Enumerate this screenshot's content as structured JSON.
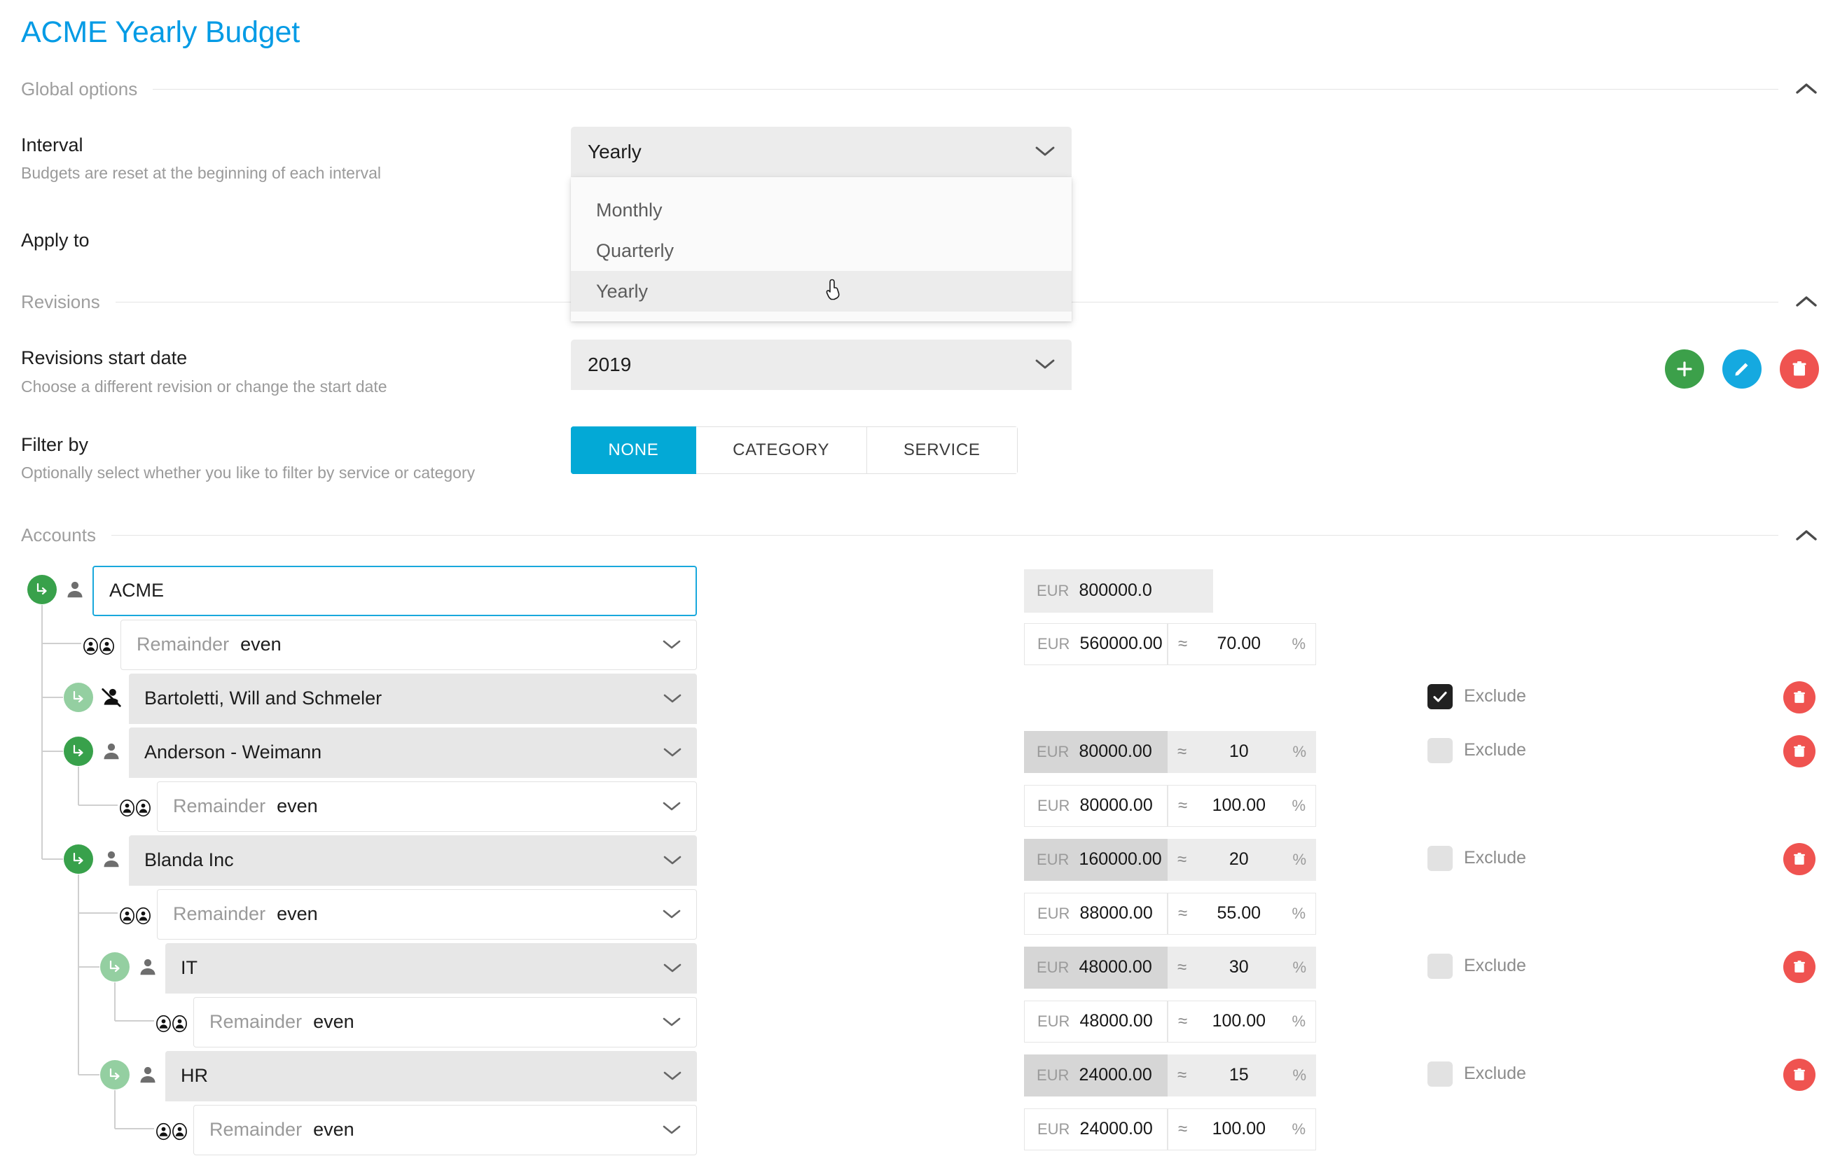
{
  "page": {
    "title": "ACME Yearly Budget"
  },
  "sections": {
    "global_options": {
      "label": "Global options",
      "collapse_icon": "chevron-up-icon"
    },
    "revisions": {
      "label": "Revisions",
      "collapse_icon": "chevron-up-icon"
    },
    "accounts": {
      "label": "Accounts",
      "collapse_icon": "chevron-up-icon"
    }
  },
  "interval": {
    "label": "Interval",
    "description": "Budgets are reset at the beginning of each interval",
    "value": "Yearly",
    "chevron_icon": "chevron-down-icon",
    "options": [
      {
        "label": "Monthly",
        "selected": false
      },
      {
        "label": "Quarterly",
        "selected": false
      },
      {
        "label": "Yearly",
        "selected": true
      }
    ]
  },
  "apply_to": {
    "label": "Apply to"
  },
  "revisions_start_date": {
    "label": "Revisions start date",
    "description": "Choose a different revision or change the start date",
    "value": "2019",
    "chevron_icon": "chevron-down-icon",
    "actions": [
      {
        "name": "add-revision-button",
        "icon": "plus-icon",
        "color": "#3CA04A"
      },
      {
        "name": "edit-revision-button",
        "icon": "pencil-icon",
        "color": "#15A9E0"
      },
      {
        "name": "delete-revision-button",
        "icon": "trash-icon",
        "color": "#EF5350"
      }
    ]
  },
  "filter_by": {
    "label": "Filter by",
    "description": "Optionally select whether you like to filter by service or category",
    "options": [
      {
        "label": "NONE",
        "active": true
      },
      {
        "label": "CATEGORY",
        "active": false
      },
      {
        "label": "SERVICE",
        "active": false
      }
    ]
  },
  "accounts": {
    "remainder_label": "Remainder",
    "exclude_label": "Exclude",
    "currency": "EUR",
    "approx_symbol": "≈",
    "percent_symbol": "%",
    "rows": [
      {
        "kind": "account",
        "depth": 0,
        "name": "ACME",
        "field_style": "focus",
        "node_icon": "subdirectory-arrow-icon",
        "node_color": "dark",
        "person_icon": "person-icon",
        "amount": "800000.0",
        "amount_style": "filled-light",
        "percent": null,
        "exclude": null,
        "deletable": false
      },
      {
        "kind": "remainder",
        "depth": 1,
        "name": "even",
        "field_style": "white",
        "node_icon": "group-icon",
        "amount": "560000.00",
        "amount_style": "outline",
        "percent": "70.00",
        "percent_style": "outline",
        "exclude": null,
        "deletable": false
      },
      {
        "kind": "account",
        "depth": 1,
        "name": "Bartoletti, Will and Schmeler",
        "field_style": "grey",
        "node_icon": "subdirectory-arrow-icon",
        "node_color": "light",
        "person_icon": "person-off-icon",
        "amount": null,
        "percent": null,
        "exclude": true,
        "deletable": true
      },
      {
        "kind": "account",
        "depth": 1,
        "name": "Anderson - Weimann",
        "field_style": "grey",
        "node_icon": "subdirectory-arrow-icon",
        "node_color": "dark",
        "person_icon": "person-icon",
        "amount": "80000.00",
        "amount_style": "filled-dark",
        "percent": "10",
        "percent_style": "filled-light",
        "exclude": false,
        "deletable": true
      },
      {
        "kind": "remainder",
        "depth": 2,
        "name": "even",
        "field_style": "white",
        "node_icon": "group-icon",
        "amount": "80000.00",
        "amount_style": "outline",
        "percent": "100.00",
        "percent_style": "outline",
        "exclude": null,
        "deletable": false
      },
      {
        "kind": "account",
        "depth": 1,
        "name": "Blanda Inc",
        "field_style": "grey",
        "node_icon": "subdirectory-arrow-icon",
        "node_color": "dark",
        "person_icon": "person-icon",
        "amount": "160000.00",
        "amount_style": "filled-dark",
        "percent": "20",
        "percent_style": "filled-light",
        "exclude": false,
        "deletable": true
      },
      {
        "kind": "remainder",
        "depth": 2,
        "name": "even",
        "field_style": "white",
        "node_icon": "group-icon",
        "amount": "88000.00",
        "amount_style": "outline",
        "percent": "55.00",
        "percent_style": "outline",
        "exclude": null,
        "deletable": false
      },
      {
        "kind": "account",
        "depth": 2,
        "name": "IT",
        "field_style": "grey",
        "node_icon": "subdirectory-arrow-icon",
        "node_color": "light",
        "person_icon": "person-icon",
        "amount": "48000.00",
        "amount_style": "filled-dark",
        "percent": "30",
        "percent_style": "filled-light",
        "exclude": false,
        "deletable": true
      },
      {
        "kind": "remainder",
        "depth": 3,
        "name": "even",
        "field_style": "white",
        "node_icon": "group-icon",
        "amount": "48000.00",
        "amount_style": "outline",
        "percent": "100.00",
        "percent_style": "outline",
        "exclude": null,
        "deletable": false
      },
      {
        "kind": "account",
        "depth": 2,
        "name": "HR",
        "field_style": "grey",
        "node_icon": "subdirectory-arrow-icon",
        "node_color": "light",
        "person_icon": "person-icon",
        "amount": "24000.00",
        "amount_style": "filled-dark",
        "percent": "15",
        "percent_style": "filled-light",
        "exclude": false,
        "deletable": true
      },
      {
        "kind": "remainder",
        "depth": 3,
        "name": "even",
        "field_style": "white",
        "node_icon": "group-icon",
        "amount": "24000.00",
        "amount_style": "outline",
        "percent": "100.00",
        "percent_style": "outline",
        "exclude": null,
        "deletable": false
      }
    ]
  }
}
